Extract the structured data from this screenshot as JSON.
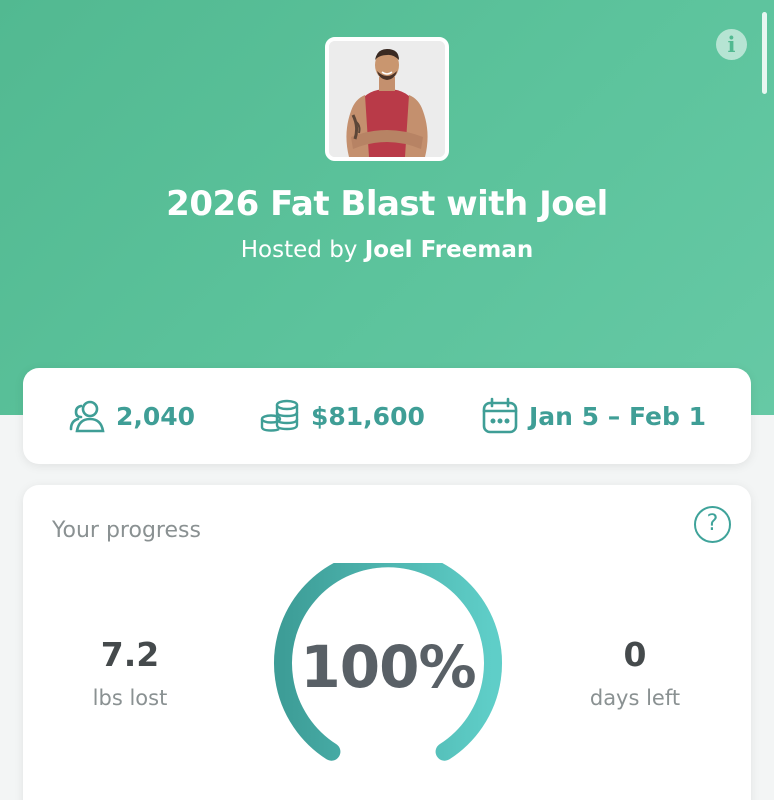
{
  "challenge": {
    "title": "2026 Fat Blast with Joel",
    "hosted_by_prefix": "Hosted by",
    "host_name": "Joel Freeman"
  },
  "stats": {
    "members": "2,040",
    "pot": "$81,600",
    "dates": "Jan 5 – Feb 1"
  },
  "progress": {
    "title": "Your progress",
    "help_symbol": "?",
    "percent_label": "100%",
    "percent_value": 100,
    "lbs_lost": "7.2",
    "lbs_lost_label": "lbs lost",
    "days_left": "0",
    "days_left_label": "days left"
  },
  "info_symbol": "i",
  "icons": [
    "info-icon",
    "members-icon",
    "coins-icon",
    "calendar-icon",
    "help-icon"
  ],
  "colors": {
    "header_green": "#5cc39c",
    "accent_teal": "#3f9e96",
    "gauge_start": "#3d9d97",
    "gauge_end": "#5fcec8"
  }
}
